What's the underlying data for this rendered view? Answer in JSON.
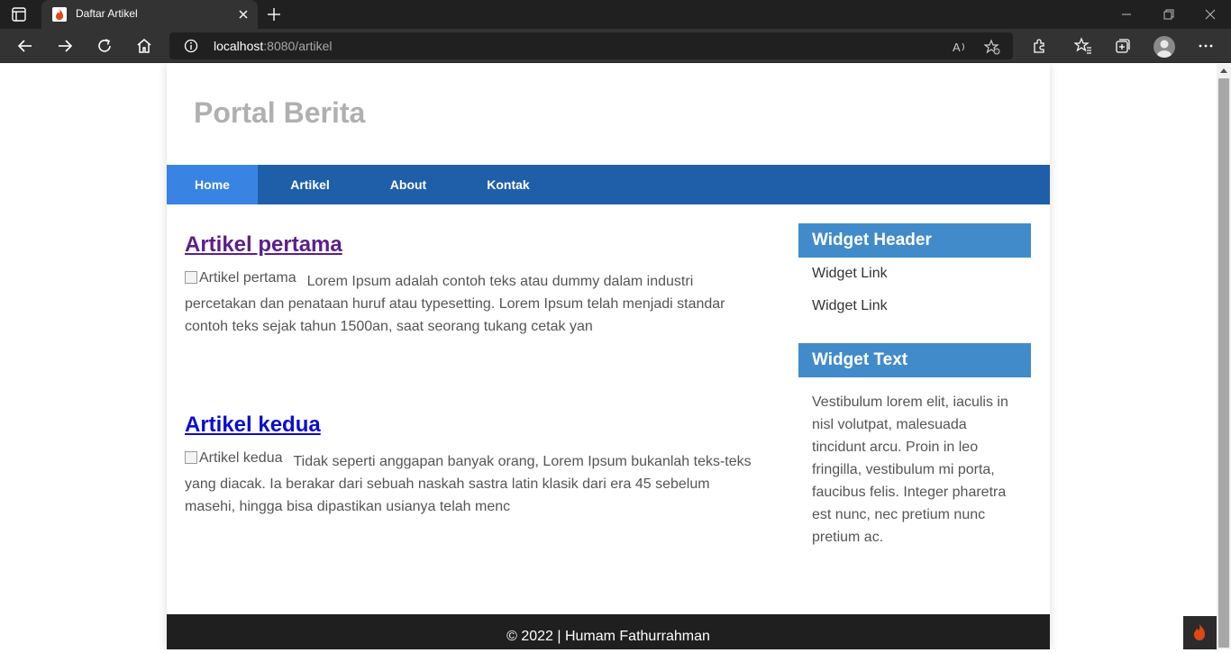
{
  "browser": {
    "tab": {
      "title": "Daftar Artikel",
      "favicon": "codeigniter-flame-icon"
    },
    "address": {
      "host": "localhost",
      "rest": ":8080/artikel"
    },
    "colors": {
      "tabbar": "#202020",
      "toolbar": "#333333"
    }
  },
  "site": {
    "title": "Portal Berita",
    "nav": [
      {
        "label": "Home",
        "active": true
      },
      {
        "label": "Artikel",
        "active": false
      },
      {
        "label": "About",
        "active": false
      },
      {
        "label": "Kontak",
        "active": false
      }
    ],
    "articles": [
      {
        "title": "Artikel pertama",
        "image_alt": "Artikel pertama",
        "excerpt": "Lorem Ipsum adalah contoh teks atau dummy dalam industri percetakan dan penataan huruf atau typesetting. Lorem Ipsum telah menjadi standar contoh teks sejak tahun 1500an, saat seorang tukang cetak yan",
        "visited": true
      },
      {
        "title": "Artikel kedua",
        "image_alt": "Artikel kedua",
        "excerpt": "Tidak seperti anggapan banyak orang, Lorem Ipsum bukanlah teks-teks yang diacak. Ia berakar dari sebuah naskah sastra latin klasik dari era 45 sebelum masehi, hingga bisa dipastikan usianya telah menc",
        "visited": false
      }
    ],
    "widgets": {
      "links_header": "Widget Header",
      "links": [
        "Widget Link",
        "Widget Link"
      ],
      "text_header": "Widget Text",
      "text": "Vestibulum lorem elit, iaculis in nisl volutpat, malesuada tincidunt arcu. Proin in leo fringilla, vestibulum mi porta, faucibus felis. Integer pharetra est nunc, nec pretium nunc pretium ac."
    },
    "footer": "© 2022 | Humam Fathurrahman",
    "colors": {
      "nav": "#1f5faa",
      "nav_active": "#3983e3",
      "widget_header": "#428bca",
      "footer": "#1f1f1f",
      "site_title": "#b0b0b0"
    }
  }
}
